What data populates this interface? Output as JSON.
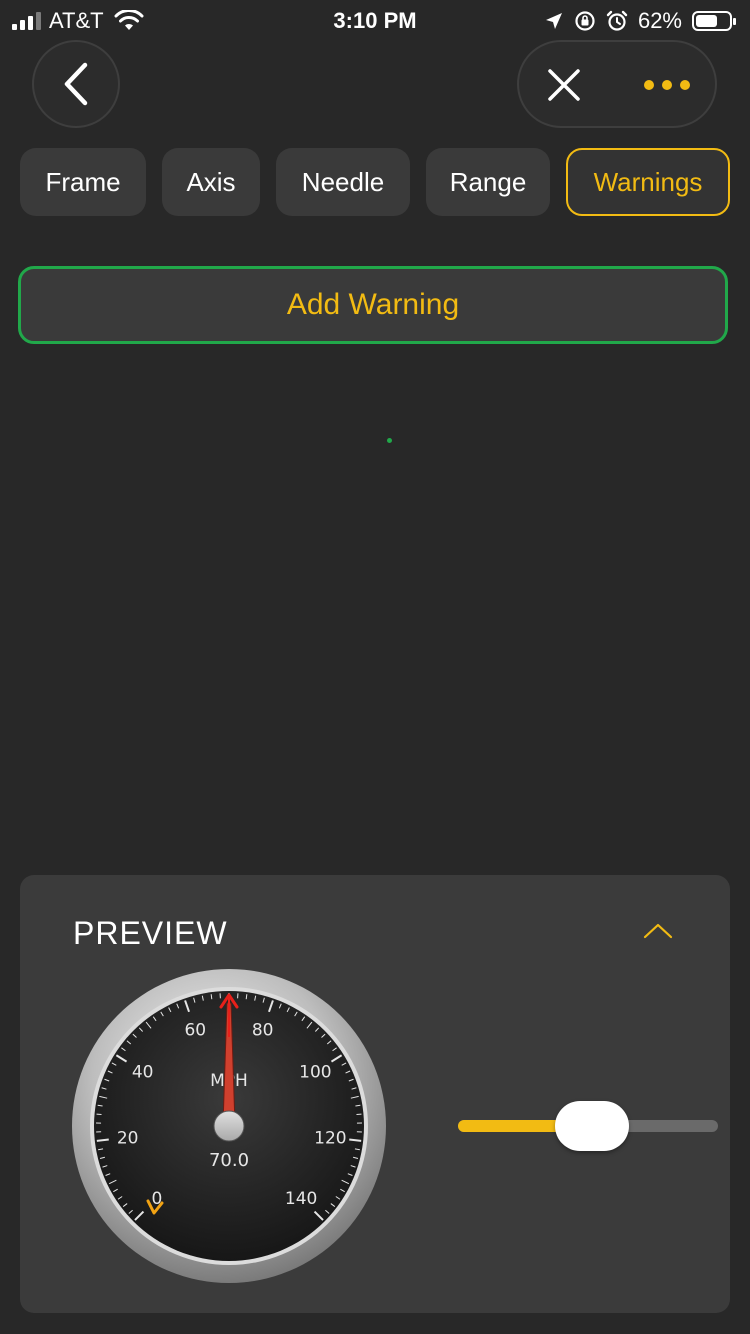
{
  "status_bar": {
    "carrier": "AT&T",
    "time": "3:10 PM",
    "battery_percent": "62%",
    "icons": [
      "signal-icon",
      "wifi-icon",
      "location-icon",
      "rotation-lock-icon",
      "alarm-icon",
      "battery-icon"
    ]
  },
  "nav": {
    "back_icon": "chevron-left-icon",
    "close_icon": "close-icon",
    "more_icon": "more-dots-icon"
  },
  "tabs": [
    {
      "label": "Frame",
      "active": false
    },
    {
      "label": "Axis",
      "active": false
    },
    {
      "label": "Needle",
      "active": false
    },
    {
      "label": "Range",
      "active": false
    },
    {
      "label": "Warnings",
      "active": true
    }
  ],
  "add_warning": {
    "label": "Add Warning"
  },
  "preview": {
    "title": "PREVIEW",
    "collapse_icon": "chevron-up-icon",
    "gauge": {
      "unit": "MPH",
      "min": 0,
      "max": 140,
      "tick_labels": [
        "0",
        "20",
        "40",
        "60",
        "80",
        "100",
        "120",
        "140"
      ],
      "value": 70.0,
      "value_text": "70.0"
    },
    "slider": {
      "value_fraction": 0.52
    }
  },
  "colors": {
    "accent": "#f2bb13",
    "success": "#21a84a",
    "background": "#282828",
    "panel": "#3b3b3b",
    "needle": "#d0402e"
  }
}
